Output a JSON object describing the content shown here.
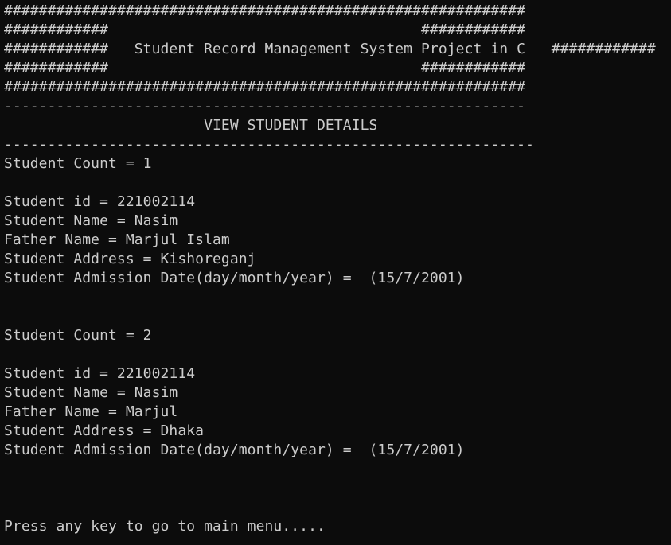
{
  "console": {
    "lines": [
      "############################################################",
      "############                                    ############",
      "############   Student Record Management System Project in C   ############",
      "############                                    ############",
      "############################################################",
      "------------------------------------------------------------",
      "                       VIEW STUDENT DETAILS",
      "-------------------------------------------------------------",
      "Student Count = 1",
      "",
      "Student id = 221002114",
      "Student Name = Nasim",
      "Father Name = Marjul Islam",
      "Student Address = Kishoreganj",
      "Student Admission Date(day/month/year) =  (15/7/2001)",
      "",
      "",
      "Student Count = 2",
      "",
      "Student id = 221002114",
      "Student Name = Nasim",
      "Father Name = Marjul",
      "Student Address = Dhaka",
      "Student Admission Date(day/month/year) =  (15/7/2001)",
      "",
      "",
      "",
      "Press any key to go to main menu....."
    ]
  }
}
